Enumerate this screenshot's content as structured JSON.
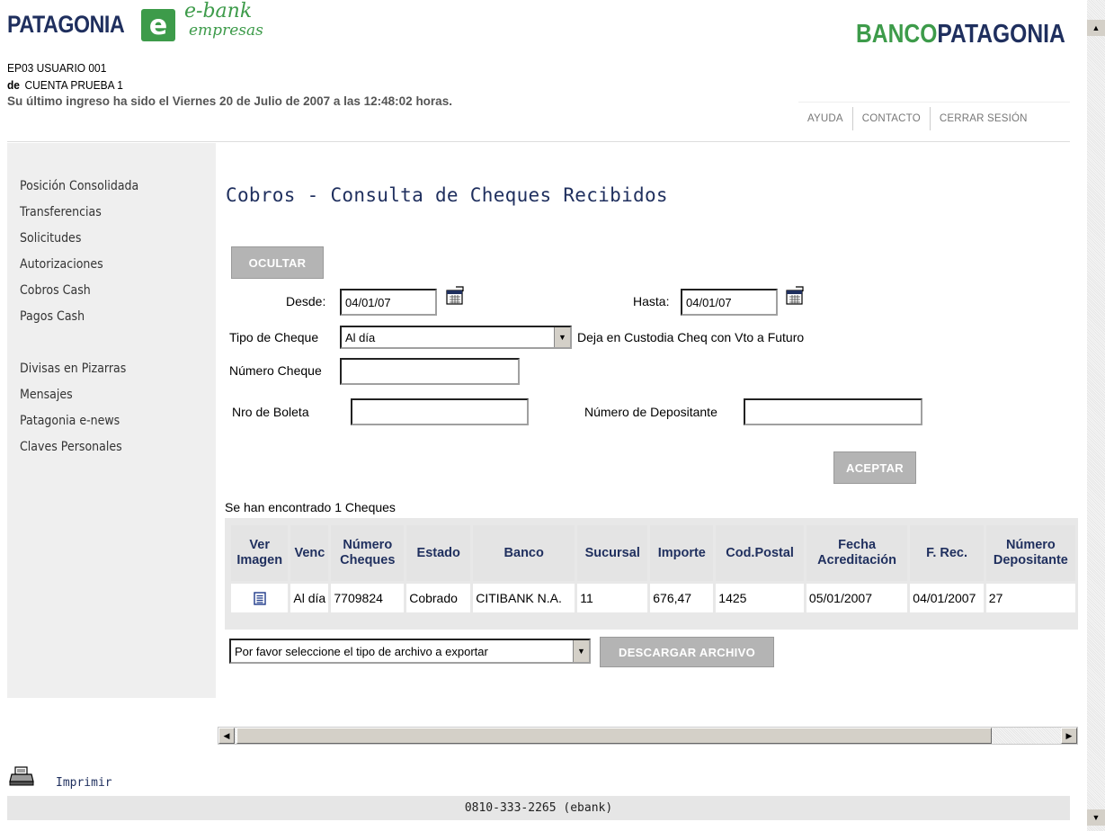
{
  "header": {
    "logo_left": "PATAGONIA",
    "logo_e": "e",
    "logo_ebank": "e-bank",
    "logo_empresas": "empresas",
    "brand_right_1": "BANCO",
    "brand_right_2": "PATAGONIA",
    "user": "EP03 USUARIO 001",
    "de_label": "de",
    "account": "CUENTA PRUEBA 1",
    "last_login": "Su último ingreso ha sido el Viernes 20 de Julio de 2007 a las 12:48:02 horas."
  },
  "topnav": [
    "AYUDA",
    "CONTACTO",
    "CERRAR SESIÓN"
  ],
  "sidebar": {
    "items": [
      "Posición Consolidada",
      "Transferencias",
      "Solicitudes",
      "Autorizaciones",
      "Cobros Cash",
      "Pagos Cash"
    ],
    "items2": [
      "Divisas en Pizarras",
      "Mensajes",
      "Patagonia e-news",
      "Claves Personales"
    ]
  },
  "main": {
    "title": "Cobros - Consulta de Cheques Recibidos",
    "ocultar": "OCULTAR",
    "desde_label": "Desde:",
    "desde_value": "04/01/07",
    "hasta_label": "Hasta:",
    "hasta_value": "04/01/07",
    "tipo_label": "Tipo de Cheque",
    "tipo_value": "Al día",
    "custodia_text": "Deja en Custodia Cheq con Vto a Futuro",
    "numero_cheque_label": "Número Cheque",
    "nro_boleta_label": "Nro de Boleta",
    "numero_depositante_label": "Número de Depositante",
    "aceptar": "ACEPTAR",
    "found": "Se han encontrado 1 Cheques"
  },
  "table": {
    "headers": [
      [
        "Ver",
        "Imagen"
      ],
      [
        "Venc"
      ],
      [
        "Número",
        "Cheques"
      ],
      [
        "Estado"
      ],
      [
        "Banco"
      ],
      [
        "Sucursal"
      ],
      [
        "Importe"
      ],
      [
        "Cod.Postal"
      ],
      [
        "Fecha",
        "Acreditación"
      ],
      [
        "F. Rec."
      ],
      [
        "Número",
        "Depositante"
      ]
    ],
    "row": {
      "venc": "Al día",
      "numero": "7709824",
      "estado": "Cobrado",
      "banco": "CITIBANK N.A.",
      "sucursal": "11",
      "importe": "676,47",
      "cod_postal": "1425",
      "fecha_acreditacion": "05/01/2007",
      "f_rec": "04/01/2007",
      "depositante": "27"
    }
  },
  "export": {
    "select_value": "Por favor seleccione el tipo de archivo a exportar",
    "download": "DESCARGAR ARCHIVO"
  },
  "print_label": "Imprimir",
  "footer_phone": "0810-333-2265 (ebank)"
}
